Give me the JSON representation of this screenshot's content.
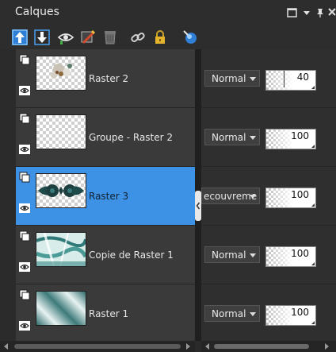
{
  "panel": {
    "title": "Calques",
    "window_icons": [
      "maximize-icon",
      "dropdown-icon",
      "pin-icon",
      "close-icon"
    ]
  },
  "toolbar": {
    "tools": [
      {
        "name": "move-layer-up-icon"
      },
      {
        "name": "move-layer-down-icon"
      },
      {
        "name": "show-hide-icon"
      },
      {
        "name": "edit-mask-icon"
      },
      {
        "name": "delete-layer-icon"
      },
      {
        "name": "link-icon"
      },
      {
        "name": "lock-icon"
      },
      {
        "name": "layer-style-icon"
      }
    ]
  },
  "layers": [
    {
      "name": "Raster 2",
      "blend_mode": "Normal",
      "opacity": "40",
      "selected": false
    },
    {
      "name": "Groupe - Raster 2",
      "blend_mode": "Normal",
      "opacity": "100",
      "selected": false
    },
    {
      "name": "Raster 3",
      "blend_mode": "ecouvreme",
      "opacity": "100",
      "selected": true
    },
    {
      "name": "Copie de Raster 1",
      "blend_mode": "Normal",
      "opacity": "100",
      "selected": false
    },
    {
      "name": "Raster 1",
      "blend_mode": "Normal",
      "opacity": "100",
      "selected": false
    }
  ],
  "colors": {
    "selection": "#3d92e6",
    "panel_bg": "#2b2b2b",
    "row_bg": "#3a3a3a"
  }
}
